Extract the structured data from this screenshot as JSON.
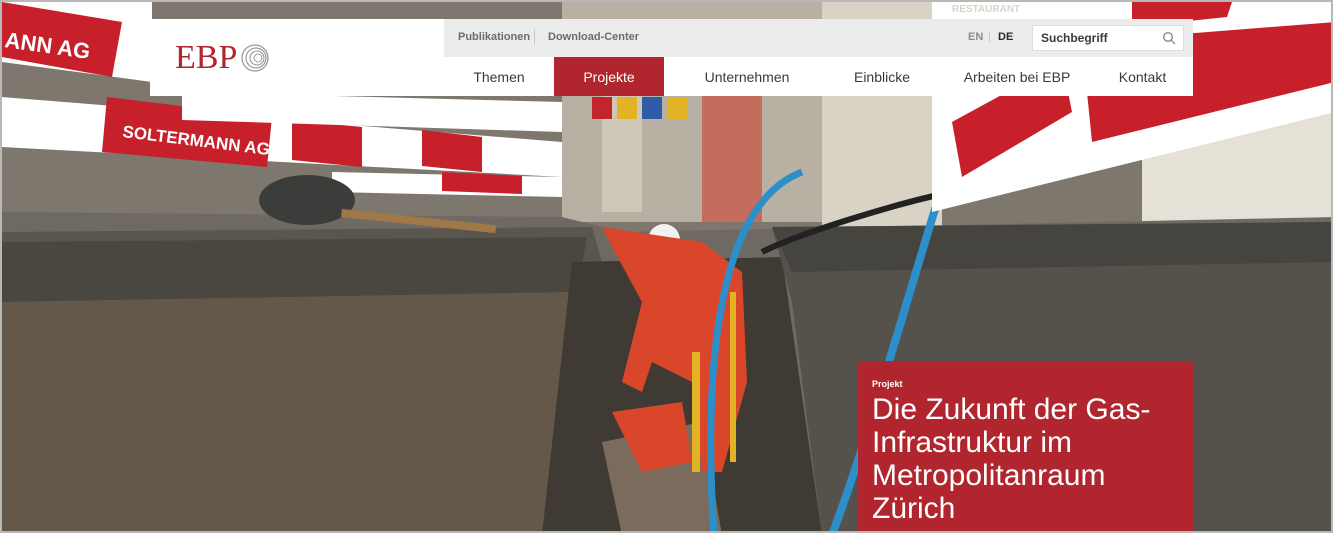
{
  "brand": {
    "logo_text": "EBP",
    "accent_color": "#b1262e",
    "logo_icon": "ebp-rings-icon"
  },
  "topbar": {
    "links": [
      {
        "label": "Publikationen"
      },
      {
        "label": "Download-Center"
      }
    ],
    "languages": [
      {
        "label": "EN",
        "active": false
      },
      {
        "label": "DE",
        "active": true
      }
    ],
    "search": {
      "placeholder": "Suchbegriff",
      "value": "",
      "icon": "search-icon"
    }
  },
  "nav": {
    "items": [
      {
        "label": "Themen",
        "active": false
      },
      {
        "label": "Projekte",
        "active": true
      },
      {
        "label": "Unternehmen",
        "active": false
      },
      {
        "label": "Einblicke",
        "active": false
      },
      {
        "label": "Arbeiten bei EBP",
        "active": false
      },
      {
        "label": "Kontakt",
        "active": false
      }
    ]
  },
  "hero": {
    "barrier_text_left": "SOLTERMANN AG",
    "barrier_text_top": "ANN AG",
    "barrier_text_small": "SOLTERMANN AG",
    "shop_sign": "RESTAURANT"
  },
  "teaser": {
    "kicker": "Projekt",
    "title": "Die Zukunft der Gas-Infrastruktur im Metropolitanraum Zürich"
  }
}
